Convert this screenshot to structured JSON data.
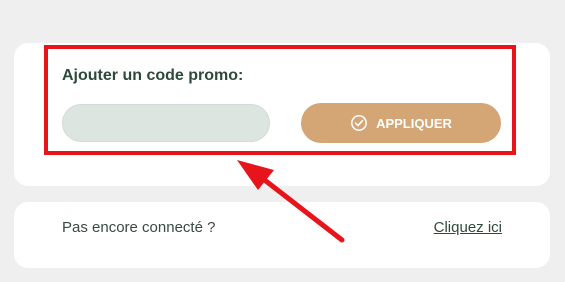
{
  "promo": {
    "title": "Ajouter un code promo:",
    "input_value": "",
    "input_placeholder": "",
    "apply_label": "APPLIQUER",
    "apply_icon": "check-circle-icon"
  },
  "login": {
    "prompt": "Pas encore connecté ?",
    "link_label": "Cliquez ici"
  },
  "annotation": {
    "highlight_color": "#e8141b",
    "arrow_color": "#e8141b"
  },
  "colors": {
    "background": "#eeefee",
    "card": "#ffffff",
    "accent": "#d4a575",
    "title_text": "#2f4a3a",
    "input_bg": "#dce5e0"
  }
}
